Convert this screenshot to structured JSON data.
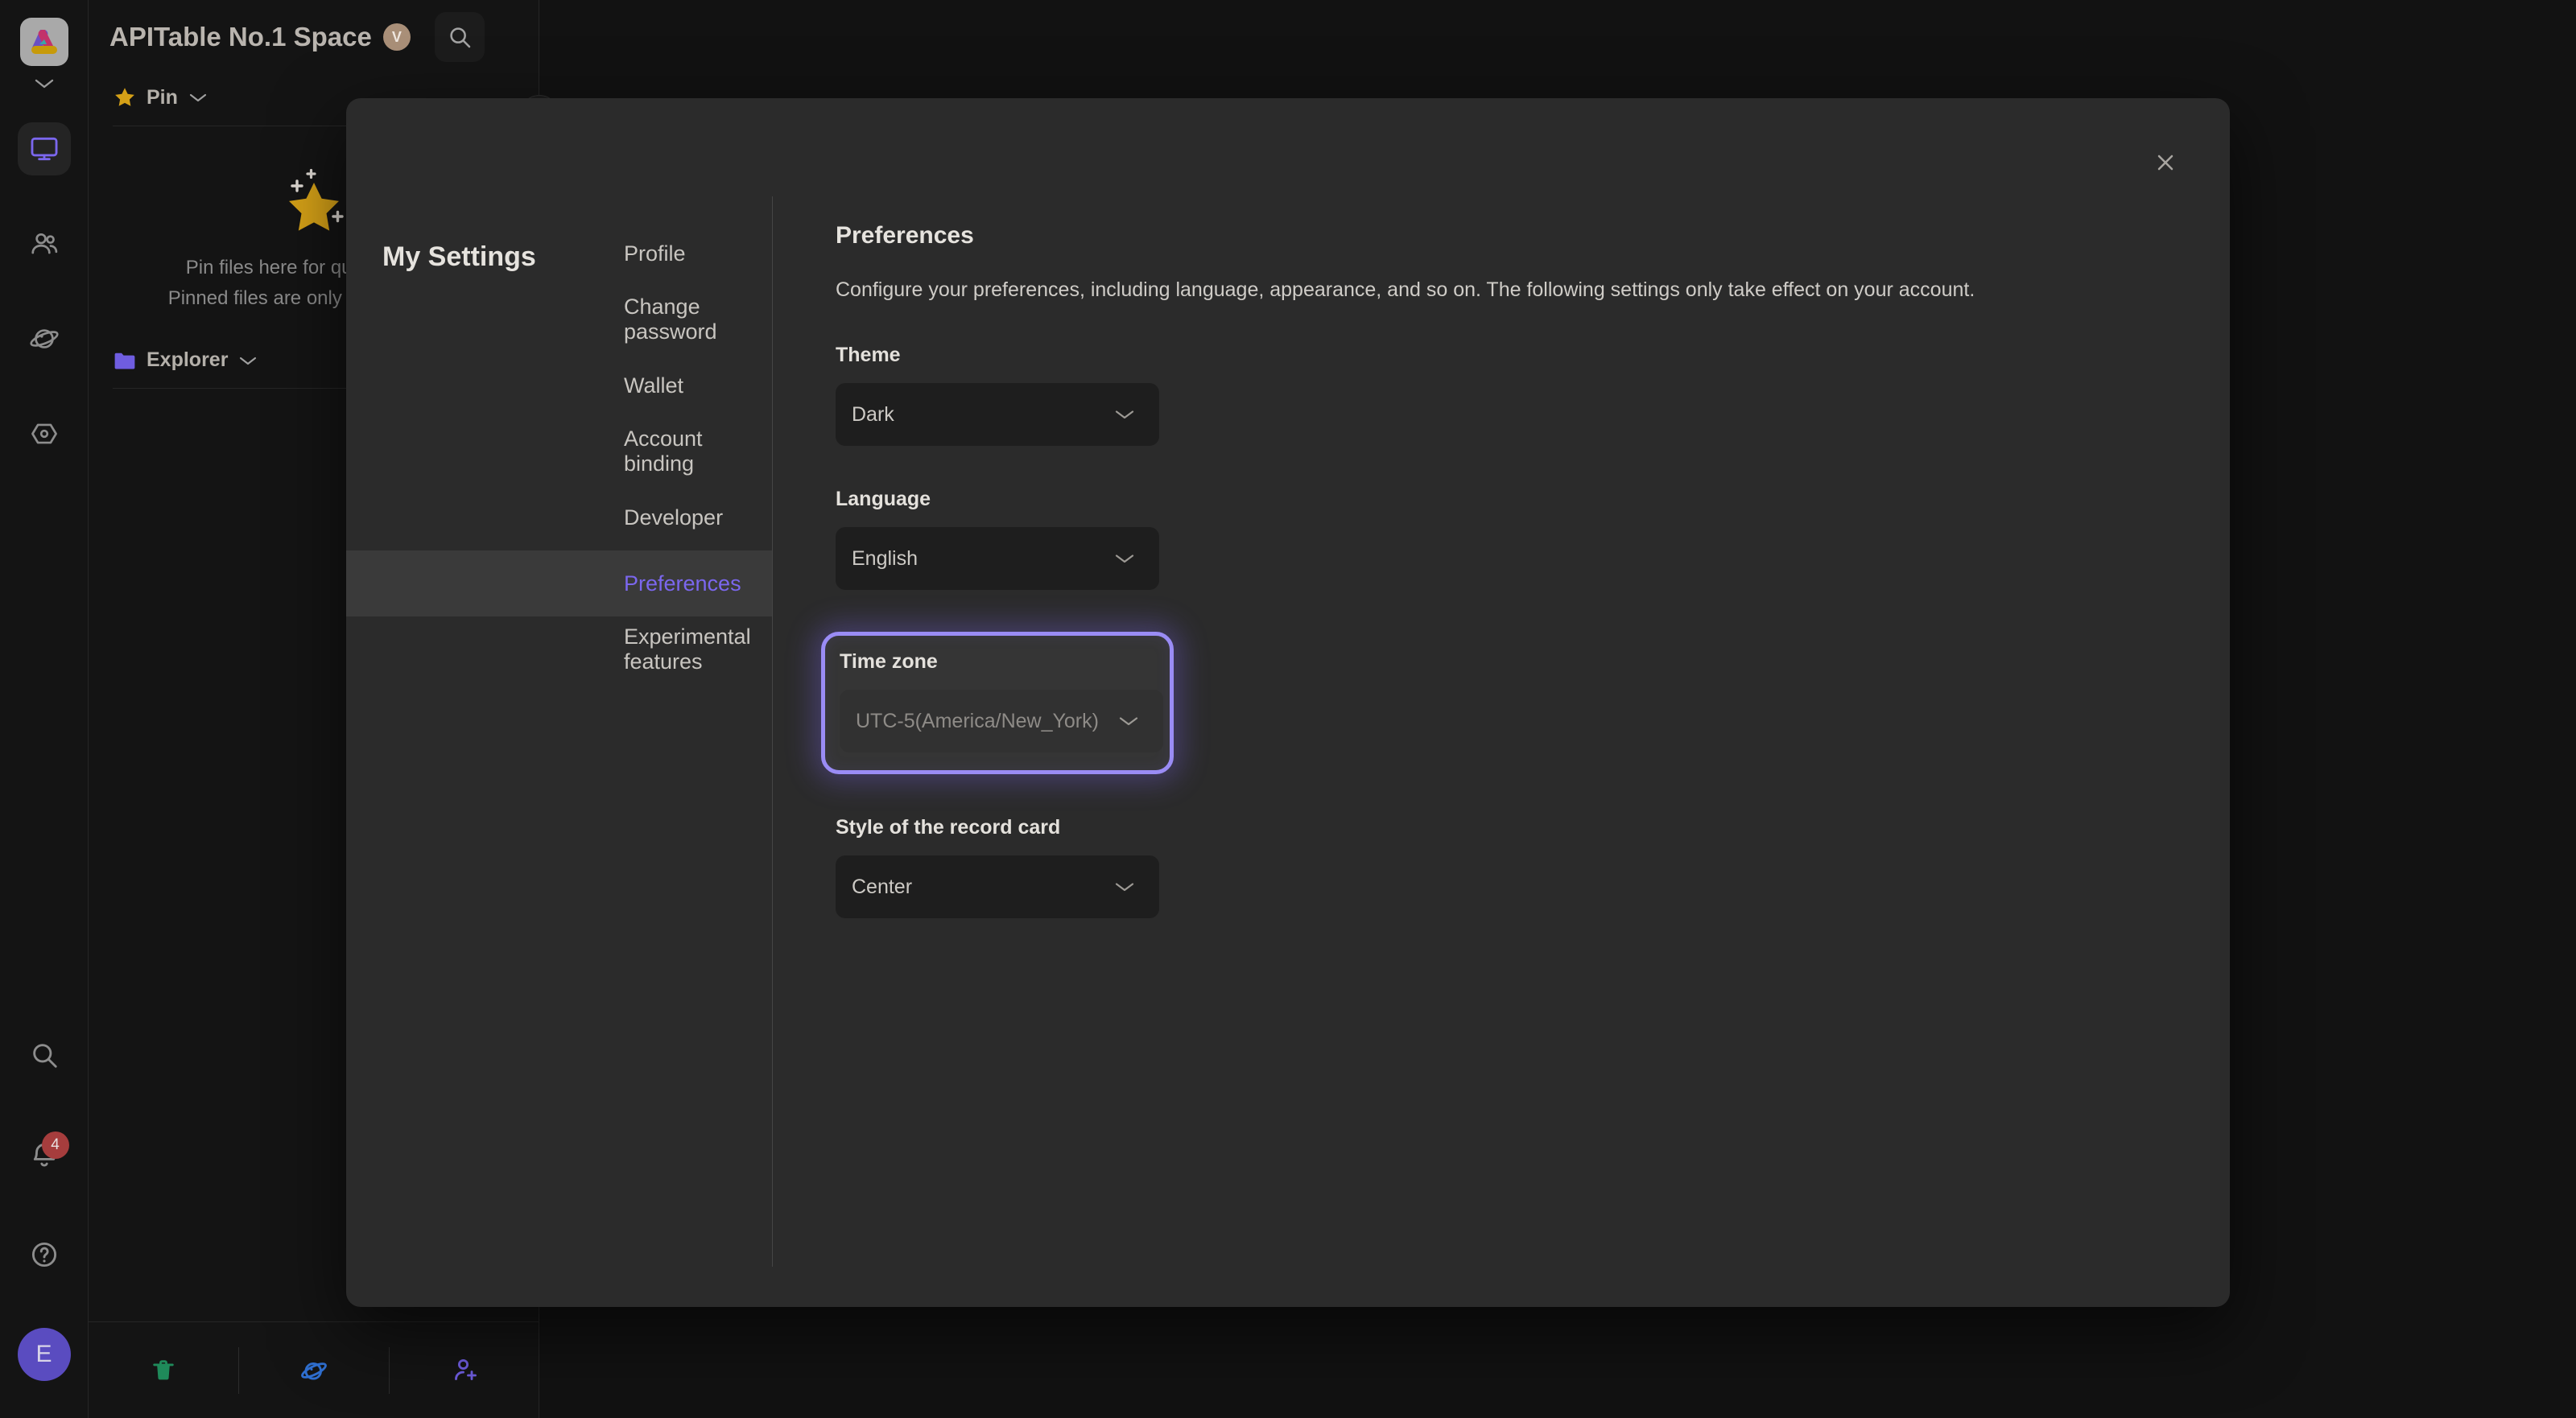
{
  "app": {
    "space_title": "APITable No.1 Space",
    "space_badge": "V",
    "logo_icon": "apitable-logo-icon",
    "rail": {
      "caret_icon": "chevron-down-icon",
      "items": [
        {
          "name": "workbench",
          "icon": "monitor-icon",
          "active": true
        },
        {
          "name": "members",
          "icon": "people-icon",
          "active": false
        },
        {
          "name": "space",
          "icon": "planet-icon",
          "active": false
        },
        {
          "name": "automation",
          "icon": "hexagon-eye-icon",
          "active": false
        }
      ],
      "bottom": {
        "search_icon": "search-icon",
        "notification_icon": "bell-icon",
        "notification_count": "4",
        "help_icon": "question-circle-icon",
        "avatar_initial": "E"
      }
    },
    "header": {
      "search_icon": "search-icon"
    },
    "panel": {
      "pin_section": {
        "label": "Pin",
        "star_icon": "star-icon",
        "chevron_icon": "chevron-down-icon",
        "empty_line1": "Pin files here for quick access",
        "empty_line2": "Pinned files are only visible to you"
      },
      "explorer_section": {
        "label": "Explorer",
        "folder_icon": "folder-icon",
        "chevron_icon": "chevron-down-icon"
      },
      "footer": [
        {
          "name": "trash",
          "icon": "trash-icon",
          "color": "#1f8a5a"
        },
        {
          "name": "space-planet",
          "icon": "planet-icon",
          "color": "#2f6fd0"
        },
        {
          "name": "invite-member",
          "icon": "add-user-icon",
          "color": "#6f5de0"
        }
      ]
    }
  },
  "modal": {
    "title": "My Settings",
    "close_icon": "close-icon",
    "nav": {
      "items": [
        {
          "label": "Profile",
          "active": false
        },
        {
          "label": "Change password",
          "active": false
        },
        {
          "label": "Wallet",
          "active": false
        },
        {
          "label": "Account binding",
          "active": false
        },
        {
          "label": "Developer",
          "active": false
        },
        {
          "label": "Preferences",
          "active": true
        },
        {
          "label": "Experimental features",
          "active": false
        }
      ]
    },
    "content": {
      "title": "Preferences",
      "description": "Configure your preferences, including language, appearance, and so on. The following settings only take effect on your account.",
      "fields": [
        {
          "label": "Theme",
          "value": "Dark",
          "chevron_icon": "chevron-down-icon",
          "highlighted": false,
          "muted": false
        },
        {
          "label": "Language",
          "value": "English",
          "chevron_icon": "chevron-down-icon",
          "highlighted": false,
          "muted": false
        },
        {
          "label": "Time zone",
          "value": "UTC-5(America/New_York)",
          "chevron_icon": "chevron-down-icon",
          "highlighted": true,
          "muted": true
        },
        {
          "label": "Style of the record card",
          "value": "Center",
          "chevron_icon": "chevron-down-icon",
          "highlighted": false,
          "muted": false
        }
      ]
    }
  },
  "colors": {
    "accent_purple": "#7b67ee",
    "highlight_border": "#9a8cf5",
    "badge_red": "#a63d3d",
    "modal_bg": "#2b2b2b",
    "app_bg": "#121212"
  }
}
